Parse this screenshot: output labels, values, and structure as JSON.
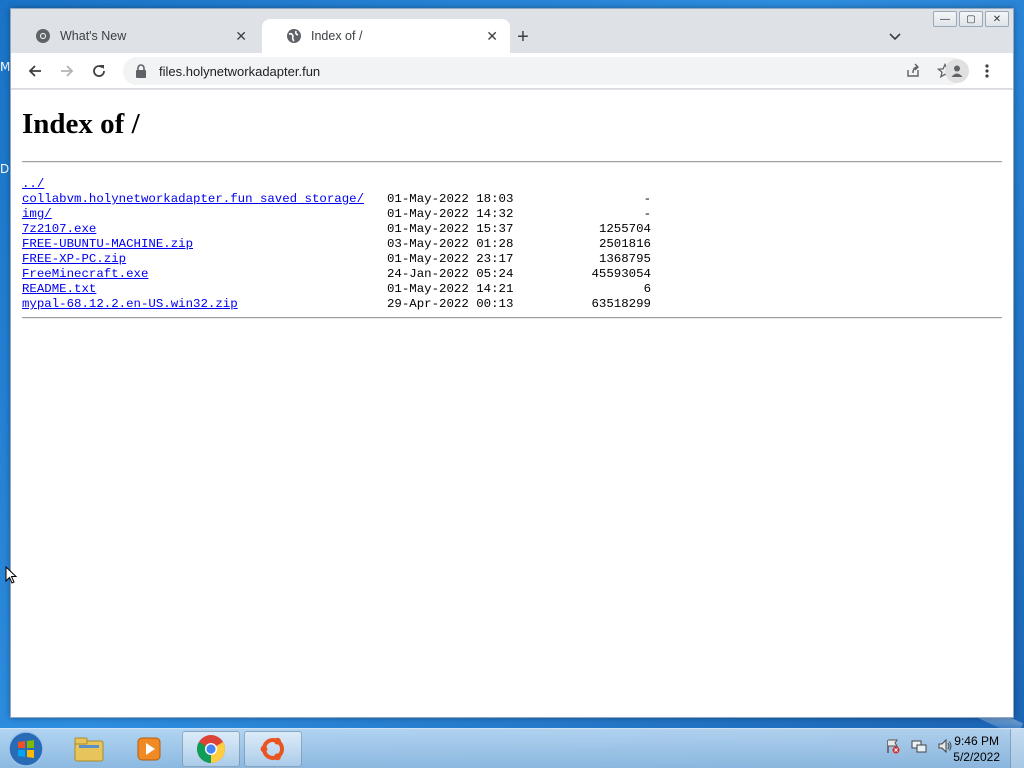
{
  "desktop": {
    "frag1": "M",
    "frag2": "D"
  },
  "window_controls": {
    "minimize": "—",
    "maximize": "▢",
    "close": "✕"
  },
  "tabs": [
    {
      "title": "What's New",
      "icon": "chrome-icon",
      "close": "✕",
      "active": false
    },
    {
      "title": "Index of /",
      "icon": "globe-icon",
      "close": "✕",
      "active": true
    }
  ],
  "new_tab_label": "+",
  "toolbar": {
    "url": "files.holynetworkadapter.fun"
  },
  "page": {
    "heading": "Index of /",
    "entries": [
      {
        "name": "../",
        "date": "",
        "size": ""
      },
      {
        "name": "collabvm.holynetworkadapter.fun saved storage/",
        "date": "01-May-2022 18:03",
        "size": "-"
      },
      {
        "name": "img/",
        "date": "01-May-2022 14:32",
        "size": "-"
      },
      {
        "name": "7z2107.exe",
        "date": "01-May-2022 15:37",
        "size": "1255704"
      },
      {
        "name": "FREE-UBUNTU-MACHINE.zip",
        "date": "03-May-2022 01:28",
        "size": "2501816"
      },
      {
        "name": "FREE-XP-PC.zip",
        "date": "01-May-2022 23:17",
        "size": "1368795"
      },
      {
        "name": "FreeMinecraft.exe",
        "date": "24-Jan-2022 05:24",
        "size": "45593054"
      },
      {
        "name": "README.txt",
        "date": "01-May-2022 14:21",
        "size": "6"
      },
      {
        "name": "mypal-68.12.2.en-US.win32.zip",
        "date": "29-Apr-2022 00:13",
        "size": "63518299"
      }
    ]
  },
  "taskbar": {
    "items": [
      "explorer-icon",
      "media-player-icon",
      "chrome-icon",
      "ubuntu-icon"
    ],
    "clock_time": "9:46 PM",
    "clock_date": "5/2/2022"
  },
  "colors": {
    "link": "#0000ee",
    "chrome_frame": "#dee1e6",
    "taskbar": "#b9d3ea"
  }
}
